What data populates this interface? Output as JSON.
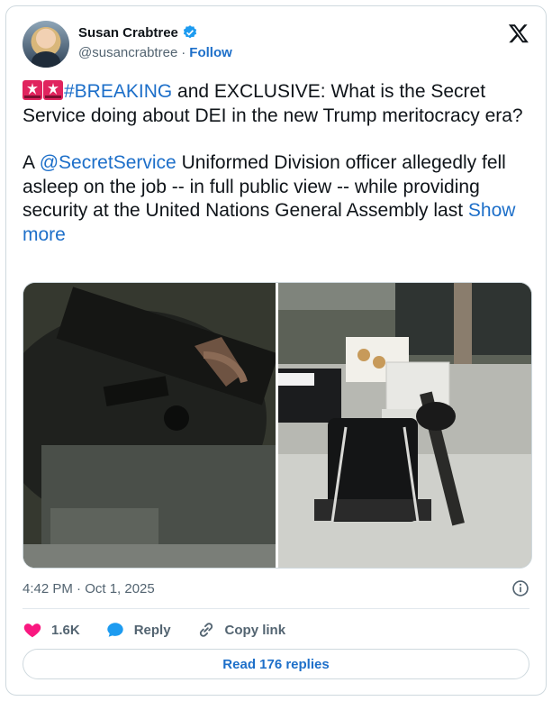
{
  "author": {
    "name": "Susan Crabtree",
    "handle": "@susancrabtree",
    "separator": "·",
    "follow_label": "Follow"
  },
  "tweet": {
    "hashtag": "#BREAKING",
    "line1_rest": " and EXCLUSIVE: What is the Secret Service doing about DEI in the new Trump meritocracy era?",
    "p2_prefix": "A ",
    "mention": "@SecretService",
    "p2_rest": " Uniformed Division officer allegedly fell asleep on the job -- in full public view -- while providing security at the United Nations General Assembly last ",
    "show_more": "Show more"
  },
  "meta": {
    "timestamp": "4:42 PM · Oct 1, 2025"
  },
  "actions": {
    "likes": "1.6K",
    "reply_label": "Reply",
    "copy_link_label": "Copy link"
  },
  "read_replies_label": "Read 176 replies",
  "colors": {
    "link": "#1d6fc9",
    "like_heart": "#f91880",
    "verified": "#1d9bf0"
  },
  "icons": [
    "verified-badge-icon",
    "x-logo-icon",
    "siren-icon",
    "info-icon",
    "heart-icon",
    "reply-icon",
    "link-icon"
  ]
}
